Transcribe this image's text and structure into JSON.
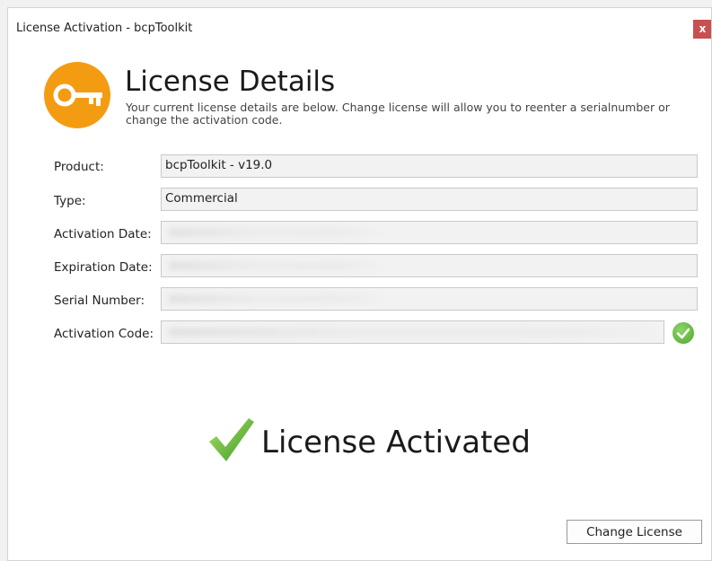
{
  "window": {
    "title": "License Activation - bcpToolkit",
    "close_label": "x"
  },
  "header": {
    "icon": "key-icon",
    "title": "License Details",
    "description": "Your current license details are below. Change license will allow you to reenter a serialnumber or change the activation code."
  },
  "fields": {
    "product": {
      "label": "Product:",
      "value": "bcpToolkit - v19.0"
    },
    "type": {
      "label": "Type:",
      "value": "Commercial"
    },
    "activation_date": {
      "label": "Activation Date:",
      "value": ""
    },
    "expiration_date": {
      "label": "Expiration Date:",
      "value": ""
    },
    "serial_number": {
      "label": "Serial Number:",
      "value": ""
    },
    "activation_code": {
      "label": "Activation Code:",
      "value": "",
      "status_icon": "check-circle-icon"
    }
  },
  "status": {
    "icon": "checkmark-icon",
    "text": "License Activated"
  },
  "actions": {
    "change_license_label": "Change License"
  },
  "colors": {
    "accent_orange": "#f39c12",
    "success_green": "#4ea82a",
    "close_red": "#c75050"
  }
}
